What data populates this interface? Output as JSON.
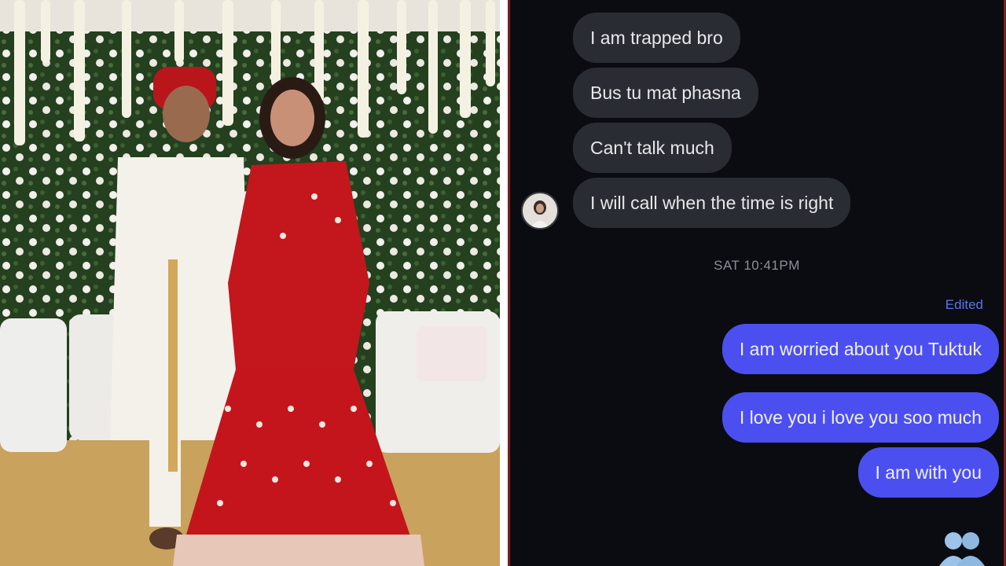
{
  "chat": {
    "incoming": [
      "I am trapped bro",
      "Bus tu mat phasna",
      "Can't talk much",
      "I will call when the time is right"
    ],
    "timestamp": "SAT 10:41PM",
    "edited_label": "Edited",
    "outgoing": [
      "I am worried about you Tuktuk",
      "I love you i love you soo much",
      "I am with you"
    ],
    "avatar_icon": "profile-avatar",
    "reaction_icon": "people-icon"
  },
  "colors": {
    "chat_bg": "#0b0c12",
    "incoming_bubble": "#2a2c33",
    "outgoing_bubble": "#4c4ff0",
    "edited_text": "#5e75e8"
  }
}
